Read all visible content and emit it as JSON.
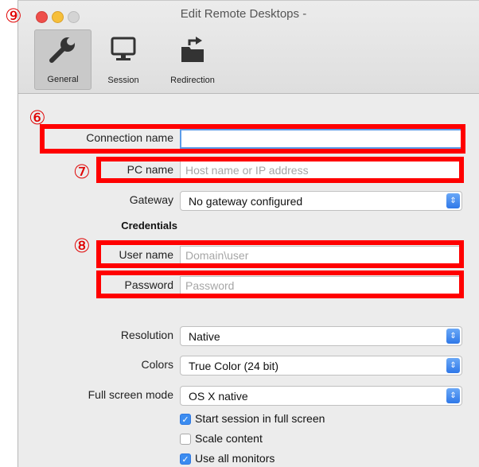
{
  "window": {
    "title": "Edit Remote Desktops -"
  },
  "toolbar": {
    "items": [
      {
        "label": "General",
        "icon": "wrench-icon",
        "active": true
      },
      {
        "label": "Session",
        "icon": "monitor-icon",
        "active": false
      },
      {
        "label": "Redirection",
        "icon": "folder-redirect-icon",
        "active": false
      }
    ]
  },
  "form": {
    "connection_name": {
      "label": "Connection name",
      "value": ""
    },
    "pc_name": {
      "label": "PC name",
      "placeholder": "Host name or IP address"
    },
    "gateway": {
      "label": "Gateway",
      "value": "No gateway configured"
    },
    "credentials_heading": "Credentials",
    "user_name": {
      "label": "User name",
      "placeholder": "Domain\\user"
    },
    "password": {
      "label": "Password",
      "placeholder": "Password"
    },
    "resolution": {
      "label": "Resolution",
      "value": "Native"
    },
    "colors": {
      "label": "Colors",
      "value": "True Color (24 bit)"
    },
    "full_screen_mode": {
      "label": "Full screen mode",
      "value": "OS X native"
    },
    "checkboxes": [
      {
        "label": "Start session in full screen",
        "checked": true
      },
      {
        "label": "Scale content",
        "checked": false
      },
      {
        "label": "Use all monitors",
        "checked": true
      }
    ]
  },
  "annotations": {
    "n6": "⑥",
    "n7": "⑦",
    "n8": "⑧",
    "n9": "⑨"
  },
  "colors": {
    "annotation": "#ff0000",
    "accent": "#3b8cf0"
  }
}
